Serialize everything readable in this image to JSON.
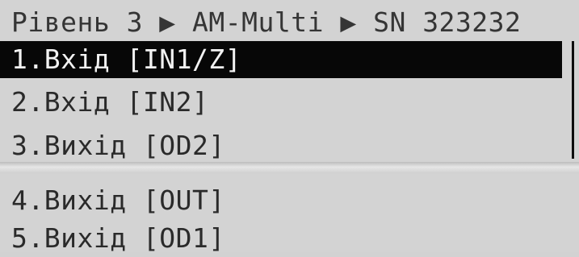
{
  "header": {
    "breadcrumb": "Рівень 3 ▶ AM-Multi ▶ SN 323232"
  },
  "menu": {
    "items": [
      {
        "label": "1.Вхід [IN1/Z]",
        "selected": true
      },
      {
        "label": "2.Вхід [IN2]",
        "selected": false
      },
      {
        "label": "3.Вихід [OD2]",
        "selected": false
      },
      {
        "label": "4.Вихід [OUT]",
        "selected": false
      },
      {
        "label": "5.Вихід [OD1]",
        "selected": false
      }
    ]
  }
}
